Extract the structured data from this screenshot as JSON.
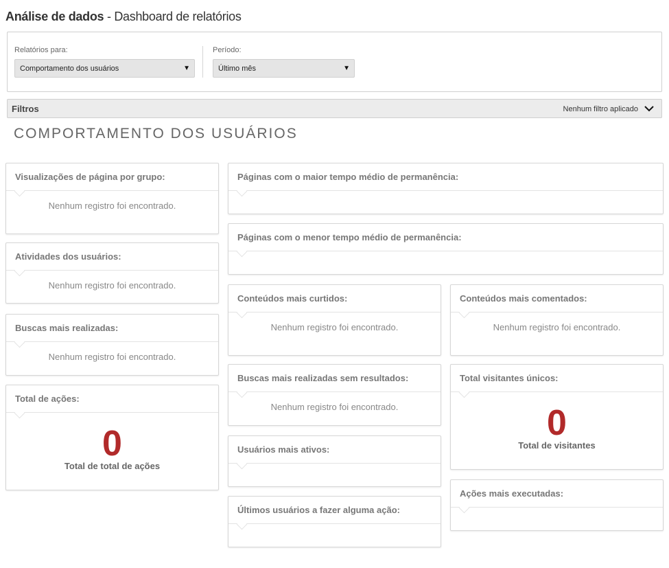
{
  "header": {
    "app_title": "Análise de dados",
    "separator": " - ",
    "subtitle": "Dashboard de relatórios"
  },
  "selectors": {
    "report_label": "Relatórios para:",
    "report_value": "Comportamento dos usuários",
    "period_label": "Período:",
    "period_value": "Último mês",
    "caret_glyph": "▼"
  },
  "filters": {
    "title": "Filtros",
    "status": "Nenhum filtro aplicado",
    "icon": "chevron-down-icon"
  },
  "section": {
    "title": "COMPORTAMENTO DOS USUÁRIOS"
  },
  "empty_message": "Nenhum registro foi encontrado.",
  "panels": {
    "page_views_by_group": {
      "title": "Visualizações de página por grupo:",
      "message": "Nenhum registro foi encontrado."
    },
    "user_activities": {
      "title": "Atividades dos usuários:",
      "message": "Nenhum registro foi encontrado."
    },
    "top_searches": {
      "title": "Buscas mais realizadas:",
      "message": "Nenhum registro foi encontrado."
    },
    "total_actions": {
      "title": "Total de ações:",
      "value": "0",
      "caption": "Total de total de ações"
    },
    "longest_time_pages": {
      "title": "Páginas com o maior tempo médio de permanência:"
    },
    "shortest_time_pages": {
      "title": "Páginas com o menor tempo médio de permanência:"
    },
    "most_liked": {
      "title": "Conteúdos mais curtidos:",
      "message": "Nenhum registro foi encontrado."
    },
    "most_commented": {
      "title": "Conteúdos mais comentados:",
      "message": "Nenhum registro foi encontrado."
    },
    "searches_no_results": {
      "title": "Buscas mais realizadas sem resultados:",
      "message": "Nenhum registro foi encontrado."
    },
    "unique_visitors": {
      "title": "Total visitantes únicos:",
      "value": "0",
      "caption": "Total de visitantes"
    },
    "most_active_users": {
      "title": "Usuários mais ativos:"
    },
    "last_active_users": {
      "title": "Últimos usuários a fazer alguma ação:"
    },
    "most_executed_actions": {
      "title": "Ações mais executadas:"
    }
  },
  "colors": {
    "accent_number": "#b12a2a",
    "panel_border": "#d6d6d6",
    "filters_bg": "#ececec"
  }
}
